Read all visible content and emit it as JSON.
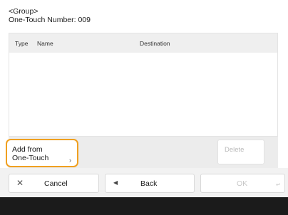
{
  "header": {
    "group_label": "<Group>",
    "number_label": "One-Touch Number: 009"
  },
  "list": {
    "columns": {
      "type": "Type",
      "name": "Name",
      "destination": "Destination"
    },
    "rows": []
  },
  "actions": {
    "add_line1": "Add from",
    "add_line2": "One-Touch",
    "delete": "Delete"
  },
  "footer_buttons": {
    "cancel": "Cancel",
    "back": "Back",
    "ok": "OK"
  },
  "icons": {
    "cancel": "close-icon",
    "back": "back-arrow-icon",
    "ok": "enter-icon",
    "add": "chevron-right-icon"
  },
  "colors": {
    "highlight": "#f0a020",
    "footer": "#1b1b1b"
  }
}
